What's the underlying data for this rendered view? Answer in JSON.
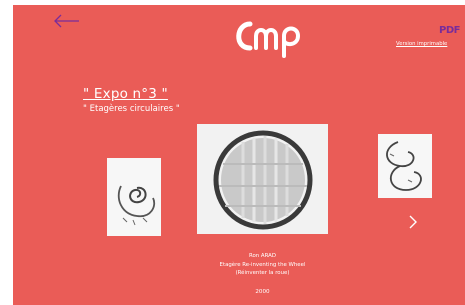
{
  "header": {
    "back_icon": "arrow-left-icon",
    "pdf_label": "PDF",
    "logo_text": "cmp",
    "print_link": "Version imprimable"
  },
  "expo": {
    "title": "\" Expo n°3 \"",
    "subtitle": "\" Etagères circulaires \""
  },
  "artwork": {
    "artist": "Ron ARAD",
    "title": "Etagère Re-inventing the Wheel",
    "translation": "(Réinventer la roue)",
    "year": "2000"
  },
  "carousel": {
    "next_icon": "chevron-right-icon"
  },
  "colors": {
    "background": "#ea5c57",
    "text": "#ffffff",
    "back_arrow": "#7a2c9a",
    "pdf": "#7a2c9a"
  }
}
